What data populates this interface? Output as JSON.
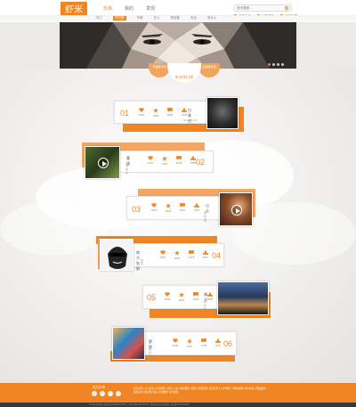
{
  "header": {
    "logo": "虾米",
    "nav": [
      {
        "label": "乐库",
        "active": true
      },
      {
        "label": "我的",
        "active": false
      },
      {
        "label": "发现",
        "active": false
      }
    ],
    "search_placeholder": "音乐搜索...",
    "utils": [
      "我的乐库",
      "消息通知",
      "用户设置"
    ],
    "sub_nav": [
      {
        "label": "热门",
        "active": false
      },
      {
        "label": "排行榜",
        "active": true
      },
      {
        "label": "专辑",
        "active": false
      },
      {
        "label": "艺人",
        "active": false
      },
      {
        "label": "精选集",
        "active": false
      },
      {
        "label": "电台",
        "active": false
      },
      {
        "label": "音乐人",
        "active": false
      }
    ]
  },
  "tabs": {
    "left": "华语排行榜",
    "main": "虾米排行榜",
    "right": "欧美排行榜"
  },
  "colors": {
    "accent": "#f08524",
    "accent_light": "#f4a763"
  },
  "cards": [
    {
      "num": "01",
      "name": "白尾过",
      "sub": "2013.01.03",
      "stats": [
        "3343",
        "2428",
        "5830",
        "2446"
      ]
    },
    {
      "num": "02",
      "name": "曹操",
      "sub": "林俊杰",
      "stats": [
        "3531",
        "2430",
        "3643",
        "3685"
      ]
    },
    {
      "num": "03",
      "name": "山丘",
      "sub": "李宗盛",
      "stats": [
        "3500",
        "3642",
        "3327",
        "2347"
      ]
    },
    {
      "num": "04",
      "name": "南方姑娘",
      "sub": "赵雷",
      "stats": [
        "3510",
        "3542",
        "3718",
        "3027"
      ]
    },
    {
      "num": "05",
      "name": "晴天",
      "sub": "周杰伦",
      "stats": [
        "3630",
        "7631",
        "3252",
        "4825"
      ]
    },
    {
      "num": "06",
      "name": "野狼",
      "sub": "痛仰乐队",
      "stats": [
        "3528",
        "963",
        "2705",
        "963"
      ]
    }
  ],
  "footer": {
    "title": "关注虾米",
    "links": "虾米音乐 | 关于虾米 | 虾米招聘 | 音乐人入驻 | 联系我们 | 帮助 | 意见反馈 | 虾米音乐人 | 合作推广 | 网站地图 | 用户协议 | 隐私政策 | 版权投诉 | 客户端下载 | 虾米微博 | 虾米微信",
    "copyright": "©2014 虾米网 | 浙网文[2013]0004-003号 | 浙ICP备10201345号 | 增值电信业务经营许可证 浙B2-20110349"
  }
}
